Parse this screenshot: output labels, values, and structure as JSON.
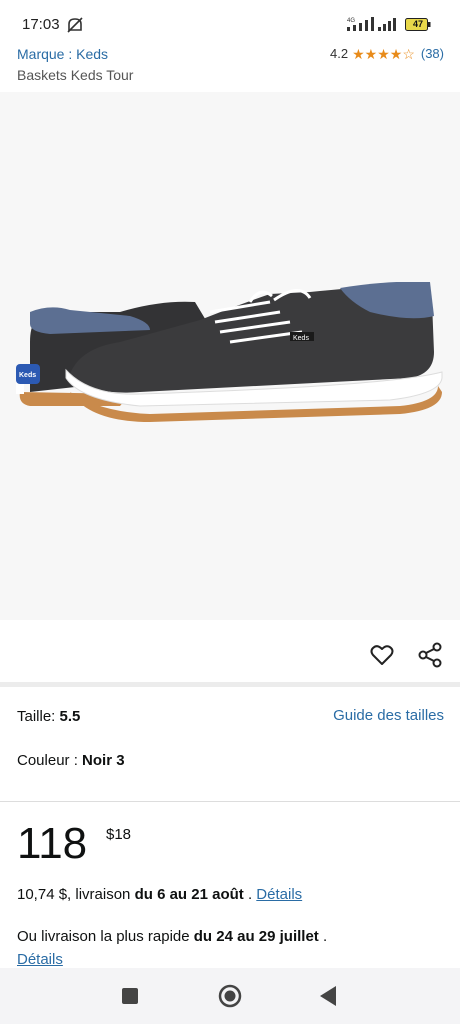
{
  "status_bar": {
    "time": "17:03",
    "network_label": "4G",
    "battery": "47",
    "icons": [
      "mute-icon",
      "signal-icon",
      "signal-icon",
      "battery-icon"
    ]
  },
  "header": {
    "brand": "Marque : Keds",
    "rating_value": "4.2",
    "rating_stars": 4.2,
    "rating_count": "(38)",
    "title": "Baskets Keds Tour"
  },
  "image": {
    "logo_text": "Keds",
    "tongue_text": "Keds",
    "colors": {
      "upper": "#3b3b3d",
      "collar": "#5c6f92",
      "sole": "#c98a4b",
      "midsole": "#ffffff",
      "badge": "#2c5ab3"
    }
  },
  "actions": {
    "icons": [
      "heart-icon",
      "share-icon"
    ]
  },
  "options": {
    "size_label": "Taille: ",
    "size_value": "5.5",
    "size_guide": "Guide des tailles",
    "color_label": "Couleur : ",
    "color_value": "Noir 3"
  },
  "price": {
    "whole": "118",
    "fraction": "$18"
  },
  "delivery": {
    "line1_price": "10,74 $, livraison ",
    "line1_dates": "du 6 au 21 août",
    "line1_sep": " . ",
    "line1_link": "Détails",
    "line2_prefix": "Ou livraison la plus rapide ",
    "line2_dates": "du 24 au 29 juillet",
    "line2_sep": " .",
    "line2_link": "Détails"
  },
  "colors": {
    "link": "#2a6ca5",
    "star": "#e88b1a",
    "price": "#0f1111"
  },
  "nav": {
    "icons": [
      "recent-apps-icon",
      "home-icon",
      "back-icon"
    ]
  }
}
